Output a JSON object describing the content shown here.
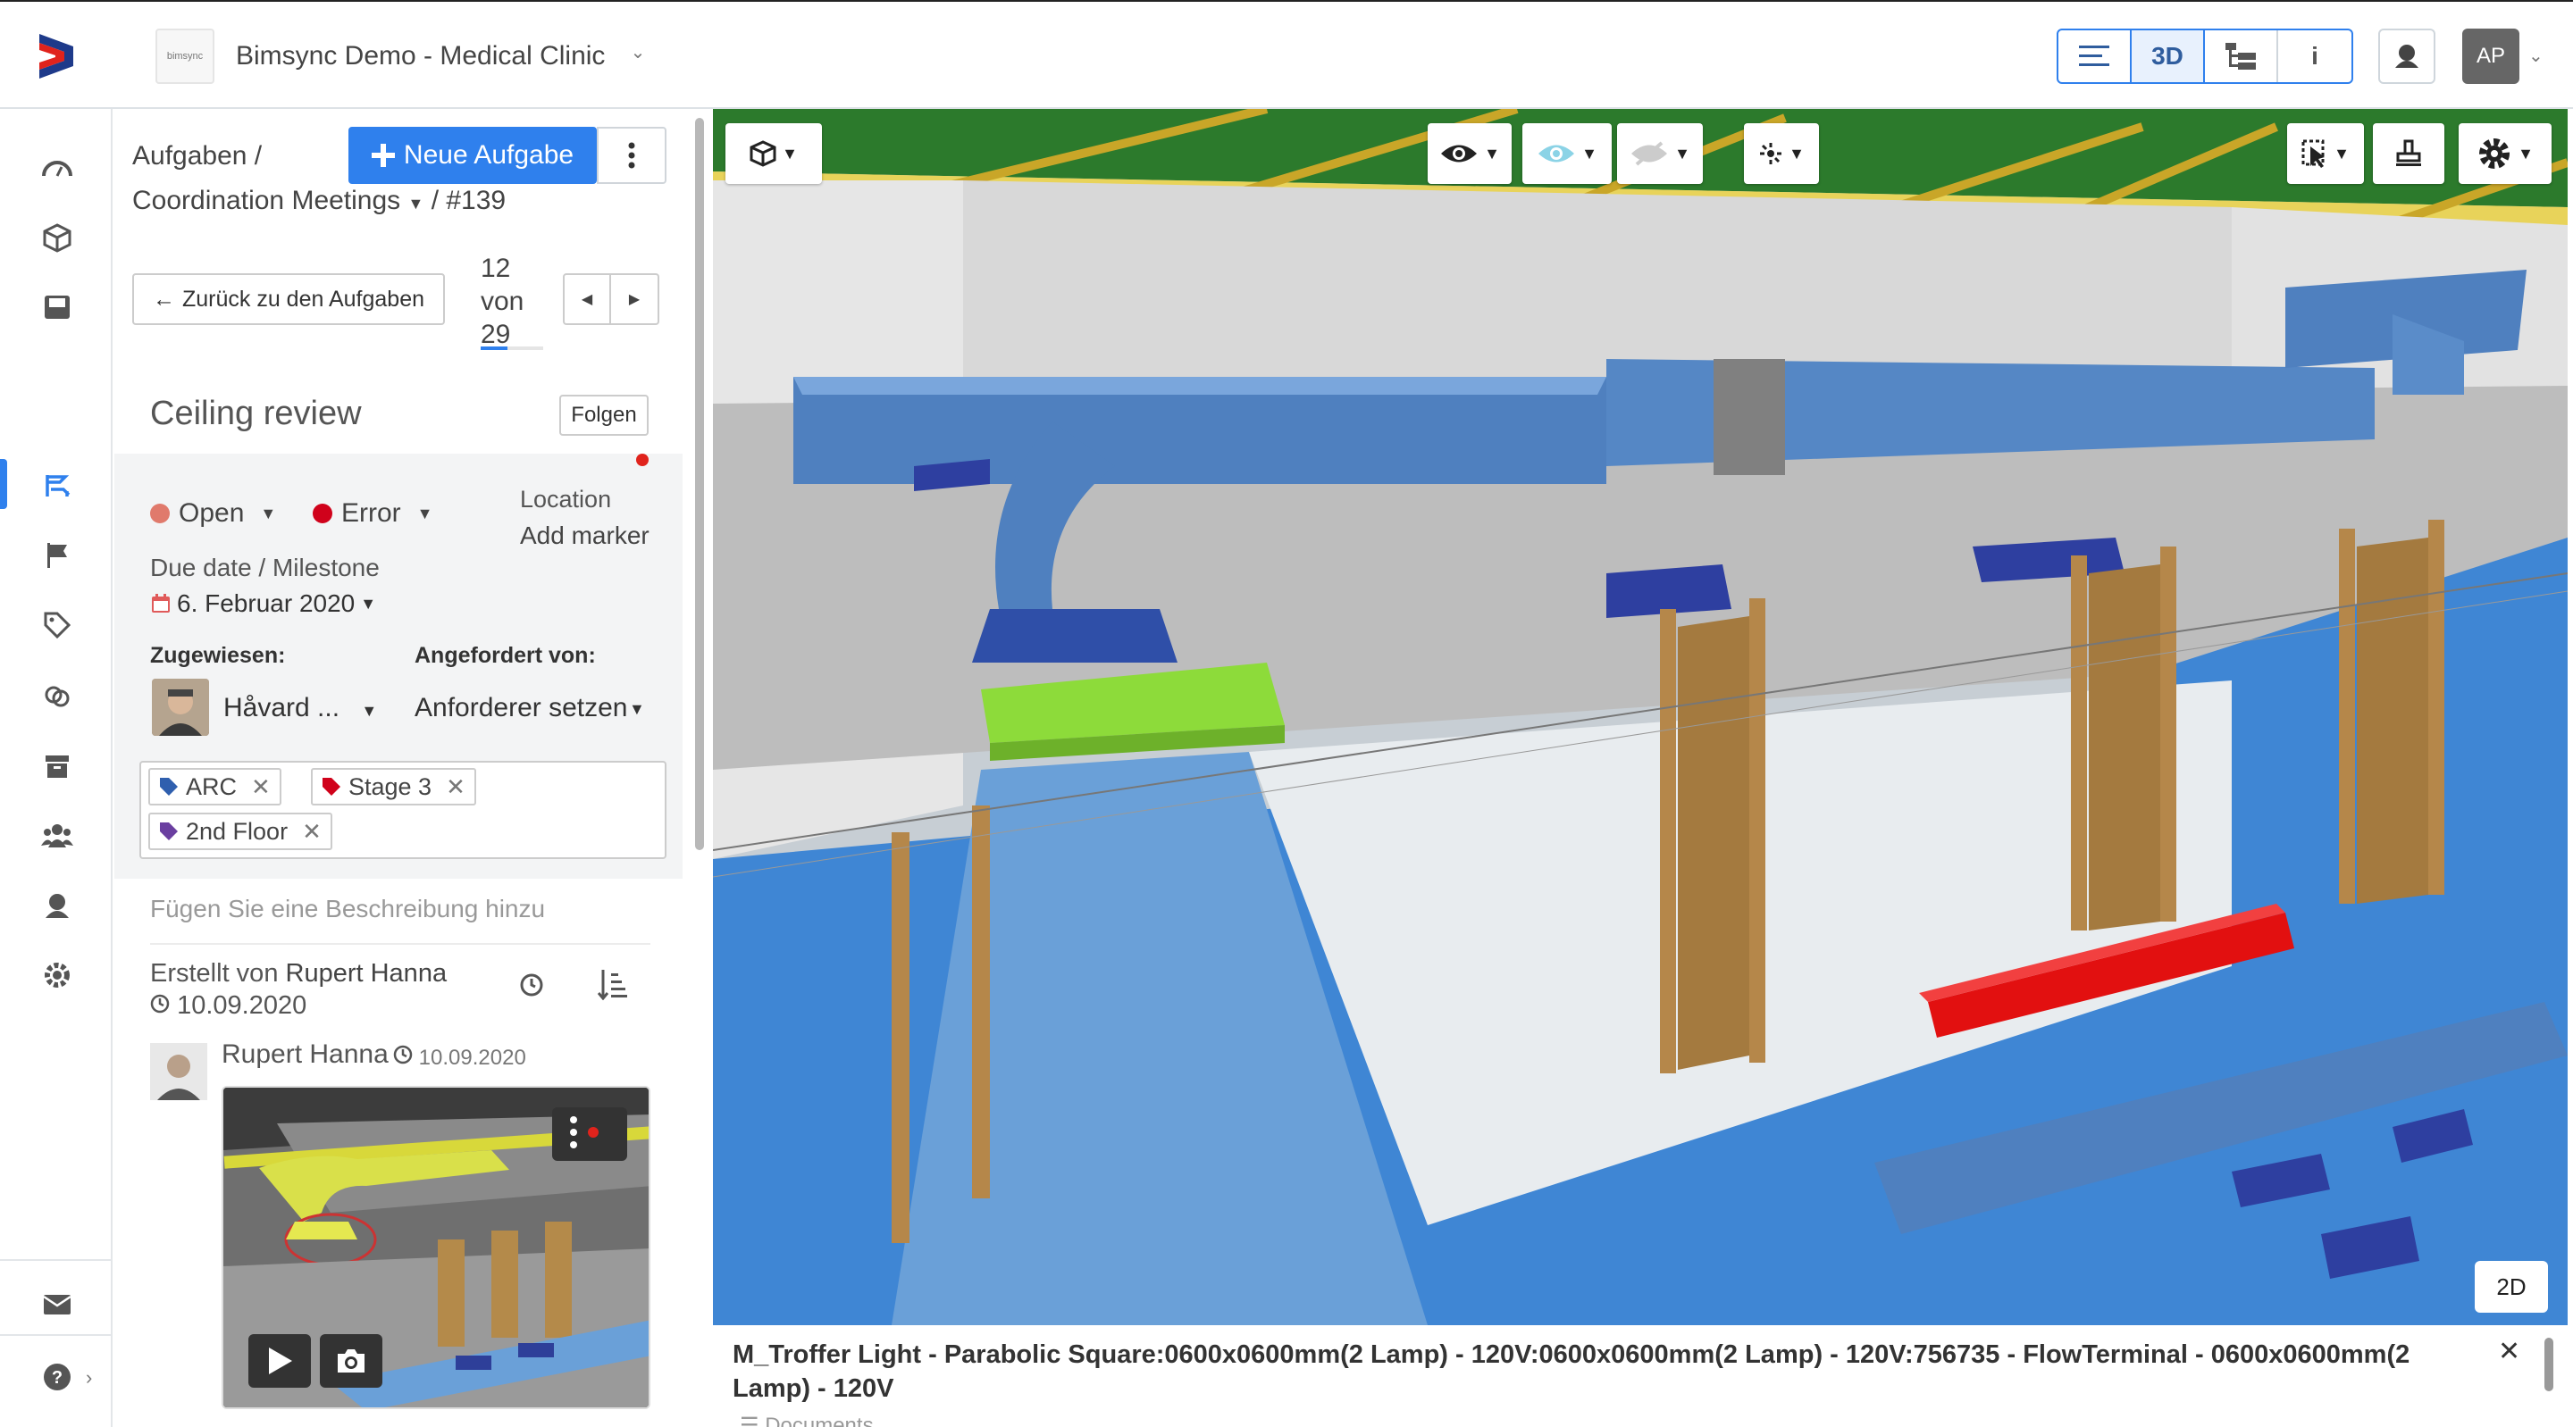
{
  "app": {
    "project_title": "Bimsync Demo - Medical Clinic",
    "project_thumb_text": "bimsync",
    "avatar_initials": "AP",
    "view_toggle": [
      "3D",
      "i"
    ]
  },
  "colors": {
    "accent": "#2f80ed",
    "open": "#e07a6c",
    "error": "#d0021b",
    "selection_red": "#e21010",
    "lime": "#8ddb3a"
  },
  "panel": {
    "breadcrumb_root": "Aufgaben /",
    "breadcrumb_list": "Coordination Meetings",
    "breadcrumb_id": "/ #139",
    "new_task_label": "Neue Aufgabe",
    "back_label": "Zurück zu den Aufgaben",
    "pager_current": "12",
    "pager_of": "von",
    "pager_total": "29",
    "issue_title": "Ceiling review",
    "follow_label": "Folgen",
    "status": "Open",
    "type": "Error",
    "location_label": "Location",
    "location_value": "Add marker",
    "due_label": "Due date / Milestone",
    "due_value": "6. Februar 2020",
    "assigned_label": "Zugewiesen:",
    "assigned_value": "Håvard ...",
    "requested_label": "Angefordert von:",
    "requested_value": "Anforderer setzen",
    "tags": [
      {
        "label": "ARC",
        "color": "#2f5fae"
      },
      {
        "label": "Stage 3",
        "color": "#d0021b"
      },
      {
        "label": "2nd Floor",
        "color": "#6a3fa0"
      }
    ],
    "description_placeholder": "Fügen Sie eine Beschreibung hinzu",
    "created_by_prefix": "Erstellt von",
    "created_by_name": "Rupert Hanna",
    "created_date": "10.09.2020",
    "comment_author": "Rupert Hanna",
    "comment_date": "10.09.2020"
  },
  "viewer": {
    "mode_2d_label": "2D",
    "selection_info": "M_Troffer Light - Parabolic Square:0600x0600mm(2 Lamp) - 120V:0600x0600mm(2 Lamp) - 120V:756735 - FlowTerminal - 0600x0600mm(2 Lamp) - 120V",
    "documents_label": "Documents"
  }
}
